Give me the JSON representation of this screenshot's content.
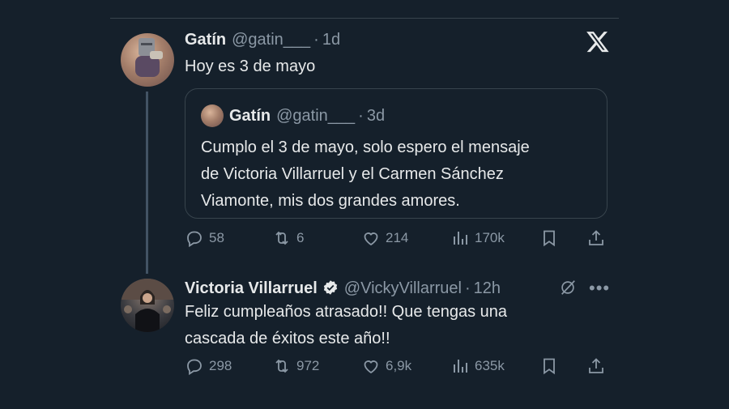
{
  "tweet1": {
    "name": "Gatín",
    "handle": "@gatin___",
    "separator": "·",
    "time": "1d",
    "text": "Hoy es 3 de mayo",
    "quote": {
      "name": "Gatín",
      "handle": "@gatin___",
      "separator": "·",
      "time": "3d",
      "text_lines": [
        "Cumplo el 3 de mayo, solo espero el mensaje",
        "de Victoria Villarruel y el Carmen Sánchez",
        "Viamonte, mis dos  grandes amores."
      ]
    },
    "actions": {
      "replies": "58",
      "reposts": "6",
      "likes": "214",
      "views": "170k"
    }
  },
  "tweet2": {
    "name": "Victoria Villarruel",
    "handle": "@VickyVillarruel",
    "separator": "·",
    "time": "12h",
    "text_lines": [
      "Feliz cumpleaños atrasado!! Que tengas una",
      "cascada de éxitos este año!!"
    ],
    "actions": {
      "replies": "298",
      "reposts": "972",
      "likes": "6,9k",
      "views": "635k"
    }
  },
  "colors": {
    "background": "#15202b",
    "text": "#e7e9ea",
    "muted": "#8b98a5",
    "border": "#38444d",
    "verified": "#1d9bf0"
  },
  "icons": [
    "x-logo-icon",
    "reply-icon",
    "repost-icon",
    "like-icon",
    "views-icon",
    "bookmark-icon",
    "share-icon",
    "verified-badge-icon",
    "grok-icon",
    "more-icon"
  ]
}
